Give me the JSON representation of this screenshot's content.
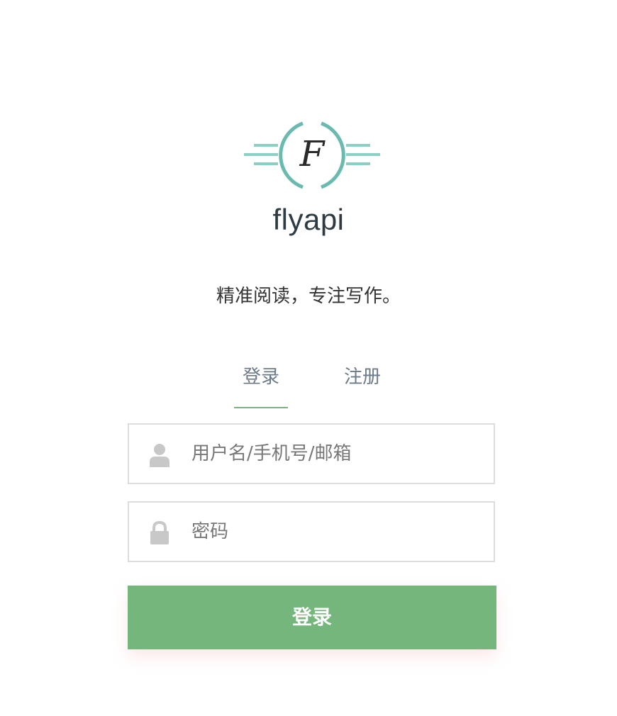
{
  "brand": {
    "logo_letter": "F",
    "name": "flyapi",
    "logo_colors": {
      "ring": "#6bbab0",
      "lines": "#8ccfc5",
      "letter": "#2a2a2a"
    }
  },
  "slogan": "精准阅读，专注写作。",
  "tabs": [
    {
      "label": "登录",
      "active": true
    },
    {
      "label": "注册",
      "active": false
    }
  ],
  "form": {
    "username": {
      "placeholder": "用户名/手机号/邮箱",
      "value": "",
      "icon": "user-icon"
    },
    "password": {
      "placeholder": "密码",
      "value": "",
      "icon": "lock-icon"
    },
    "submit_label": "登录"
  },
  "colors": {
    "accent": "#75b67c",
    "tab_text": "#6c7a89",
    "border": "#dddddd",
    "icon": "#c8c8c8"
  }
}
